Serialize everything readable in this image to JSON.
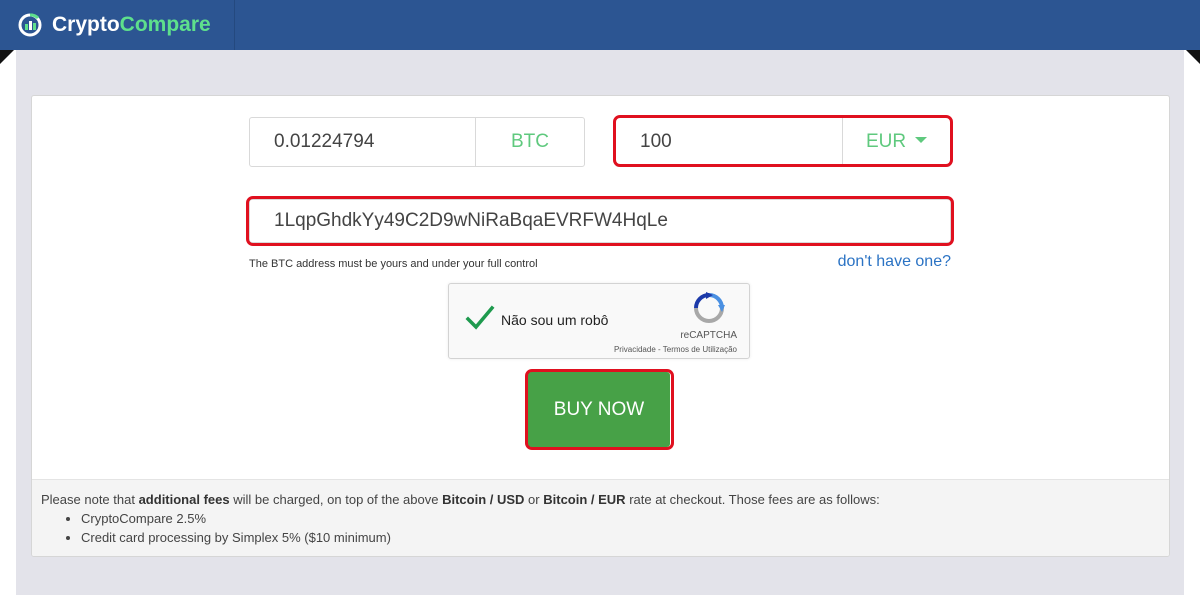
{
  "header": {
    "logo_text_part1": "Crypto",
    "logo_text_part2": "Compare",
    "colors": {
      "bar": "#2c5592",
      "logo_accent": "#5ee08c"
    }
  },
  "converter": {
    "crypto_amount": "0.01224794",
    "crypto_unit": "BTC",
    "fiat_amount": "100",
    "fiat_currency": "EUR"
  },
  "address": {
    "value": "1LqpGhdkYy49C2D9wNiRaBqaEVRFW4HqLe",
    "note": "The BTC address must be yours and under your full control",
    "help_link": "don't have one?"
  },
  "recaptcha": {
    "label": "Não sou um robô",
    "brand": "reCAPTCHA",
    "privacy": "Privacidade",
    "separator": " - ",
    "terms": "Termos de Utilização",
    "checked": true,
    "icon": "recaptcha-logo-icon"
  },
  "buy_button": {
    "label": "BUY NOW",
    "color": "#47a147"
  },
  "fees": {
    "part1": "Please note that ",
    "bold1": "additional fees",
    "part2": " will be charged, on top of the above ",
    "bold2": "Bitcoin / USD",
    "part3": " or ",
    "bold3": "Bitcoin / EUR",
    "part4": " rate at checkout. Those fees are as follows:",
    "items": [
      "CryptoCompare 2.5%",
      "Credit card processing by Simplex 5% ($10 minimum)"
    ]
  },
  "highlight_color": "#e0101f"
}
